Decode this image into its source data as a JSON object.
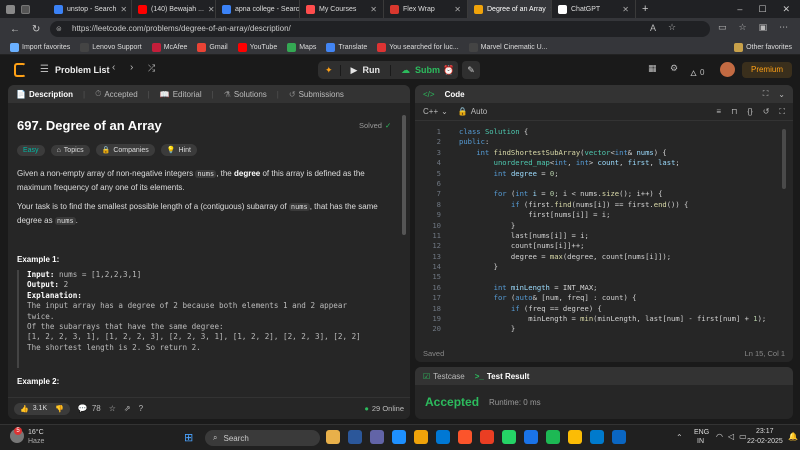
{
  "browser": {
    "tabs": [
      {
        "label": "unstop - Search",
        "color": "#3b82f6"
      },
      {
        "label": "(140) Bewajah ...",
        "color": "#ff0000"
      },
      {
        "label": "apna college - Searc",
        "color": "#3b82f6"
      },
      {
        "label": "My Courses",
        "color": "#ff4d4d"
      },
      {
        "label": "Flex Wrap",
        "color": "#d9382e"
      },
      {
        "label": "Degree of an Array",
        "color": "#f0a30a"
      },
      {
        "label": "ChatGPT",
        "color": "#ffffff"
      }
    ],
    "url": "https://leetcode.com/problems/degree-of-an-array/description/",
    "bookmarks": [
      "Import favorites",
      "Lenovo Support",
      "McAfee",
      "Gmail",
      "YouTube",
      "Maps",
      "Translate",
      "You searched for luc...",
      "Marvel Cinematic U..."
    ],
    "other_favorites": "Other favorites"
  },
  "nav": {
    "problem_list": "Problem List",
    "run": "Run",
    "submit": "Submit",
    "streak": "0",
    "premium": "Premium"
  },
  "left": {
    "tabs": [
      "Description",
      "Accepted",
      "Editorial",
      "Solutions",
      "Submissions"
    ],
    "title": "697. Degree of an Array",
    "solved": "Solved",
    "difficulty": "Easy",
    "chips": [
      "Topics",
      "Companies",
      "Hint"
    ],
    "para1a": "Given a non-empty array of non-negative integers ",
    "para1code": "nums",
    "para1b": ", the ",
    "para1bold": "degree",
    "para1c": " of this array is defined as the maximum frequency of any one of its elements.",
    "para2a": "Your task is to find the smallest possible length of a (contiguous) subarray of ",
    "para2code": "nums",
    "para2b": ", that has the same degree as ",
    "para2code2": "nums",
    "para2c": ".",
    "ex1_title": "Example 1:",
    "ex1_input_label": "Input:",
    "ex1_input": " nums = [1,2,2,3,1]",
    "ex1_output_label": "Output:",
    "ex1_output": " 2",
    "ex1_expl_label": "Explanation:",
    "ex1_lines": [
      "The input array has a degree of 2 because both elements 1 and 2 appear",
      "twice.",
      "Of the subarrays that have the same degree:",
      "[1, 2, 2, 3, 1], [1, 2, 2, 3], [2, 2, 3, 1], [1, 2, 2], [2, 2, 3], [2, 2]",
      "The shortest length is 2. So return 2."
    ],
    "ex2_title": "Example 2:",
    "likes": "3.1K",
    "comments": "78",
    "online": "29 Online"
  },
  "code": {
    "header": "Code",
    "lang": "C++",
    "mode": "Auto",
    "saved": "Saved",
    "cursor": "Ln 15, Col 1",
    "lines": [
      [
        [
          "kw",
          "class "
        ],
        [
          "ty",
          "Solution "
        ],
        [
          "pl",
          "{"
        ]
      ],
      [
        [
          "kw",
          "public"
        ],
        [
          "pl",
          ":"
        ]
      ],
      [
        [
          "pl",
          "    "
        ],
        [
          "kw",
          "int "
        ],
        [
          "fn",
          "findShortestSubArray"
        ],
        [
          "pl",
          "("
        ],
        [
          "ty",
          "vector"
        ],
        [
          "pl",
          "<"
        ],
        [
          "kw",
          "int"
        ],
        [
          "pl",
          "& "
        ],
        [
          "vr",
          "nums"
        ],
        [
          "pl",
          ") {"
        ]
      ],
      [
        [
          "pl",
          "        "
        ],
        [
          "ty",
          "unordered_map"
        ],
        [
          "pl",
          "<"
        ],
        [
          "kw",
          "int"
        ],
        [
          "pl",
          ", "
        ],
        [
          "kw",
          "int"
        ],
        [
          "pl",
          "> "
        ],
        [
          "vr",
          "count"
        ],
        [
          "pl",
          ", "
        ],
        [
          "vr",
          "first"
        ],
        [
          "pl",
          ", "
        ],
        [
          "vr",
          "last"
        ],
        [
          "pl",
          ";"
        ]
      ],
      [
        [
          "pl",
          "        "
        ],
        [
          "kw",
          "int "
        ],
        [
          "vr",
          "degree"
        ],
        [
          "pl",
          " = "
        ],
        [
          "nm",
          "0"
        ],
        [
          "pl",
          ";"
        ]
      ],
      [
        [
          "pl",
          ""
        ]
      ],
      [
        [
          "pl",
          "        "
        ],
        [
          "kw",
          "for "
        ],
        [
          "pl",
          "("
        ],
        [
          "kw",
          "int "
        ],
        [
          "vr",
          "i"
        ],
        [
          "pl",
          " = "
        ],
        [
          "nm",
          "0"
        ],
        [
          "pl",
          "; i < nums."
        ],
        [
          "fn",
          "size"
        ],
        [
          "pl",
          "(); i++) {"
        ]
      ],
      [
        [
          "pl",
          "            "
        ],
        [
          "kw",
          "if "
        ],
        [
          "pl",
          "(first."
        ],
        [
          "fn",
          "find"
        ],
        [
          "pl",
          "(nums[i]) == first."
        ],
        [
          "fn",
          "end"
        ],
        [
          "pl",
          "()) {"
        ]
      ],
      [
        [
          "pl",
          "                first[nums[i]] = i;"
        ]
      ],
      [
        [
          "pl",
          "            }"
        ]
      ],
      [
        [
          "pl",
          "            last[nums[i]] = i;"
        ]
      ],
      [
        [
          "pl",
          "            count[nums[i]]++;"
        ]
      ],
      [
        [
          "pl",
          "            degree = "
        ],
        [
          "fn",
          "max"
        ],
        [
          "pl",
          "(degree, count[nums[i]]);"
        ]
      ],
      [
        [
          "pl",
          "        }"
        ]
      ],
      [
        [
          "pl",
          ""
        ]
      ],
      [
        [
          "pl",
          "        "
        ],
        [
          "kw",
          "int "
        ],
        [
          "vr",
          "minLength"
        ],
        [
          "pl",
          " = INT_MAX;"
        ]
      ],
      [
        [
          "pl",
          "        "
        ],
        [
          "kw",
          "for "
        ],
        [
          "pl",
          "("
        ],
        [
          "kw",
          "auto"
        ],
        [
          "pl",
          "& [num, freq] : count) {"
        ]
      ],
      [
        [
          "pl",
          "            "
        ],
        [
          "kw",
          "if "
        ],
        [
          "pl",
          "(freq == degree) {"
        ]
      ],
      [
        [
          "pl",
          "                minLength = "
        ],
        [
          "fn",
          "min"
        ],
        [
          "pl",
          "(minLength, last[num] - first[num] + "
        ],
        [
          "nm",
          "1"
        ],
        [
          "pl",
          ");"
        ]
      ],
      [
        [
          "pl",
          "            }"
        ]
      ]
    ]
  },
  "testcase": {
    "tab1": "Testcase",
    "tab2": "Test Result",
    "status": "Accepted",
    "runtime": "Runtime: 0 ms"
  },
  "taskbar": {
    "temp": "16°C",
    "weather": "Haze",
    "search": "Search",
    "lang1": "ENG",
    "lang2": "IN",
    "time": "23:17",
    "date": "22-02-2025",
    "badge": "5"
  },
  "colors": {
    "accent_orange": "#ffa116",
    "run_green": "#2cbb5d",
    "accepted": "#2cbb5d",
    "easy": "#00b8a3"
  }
}
